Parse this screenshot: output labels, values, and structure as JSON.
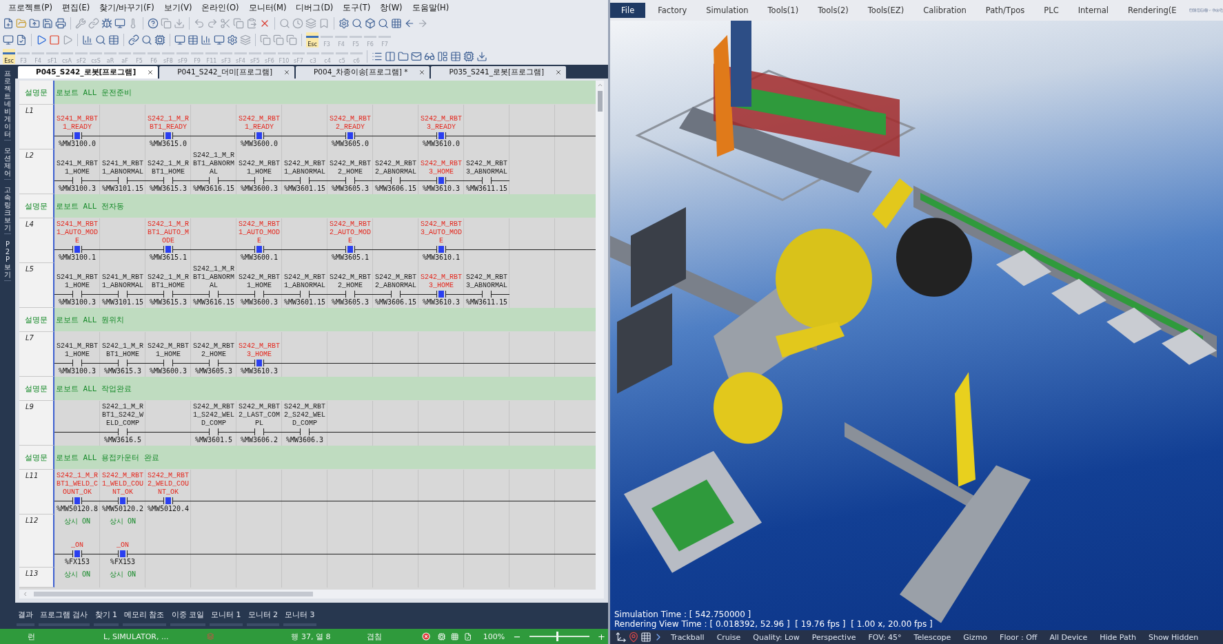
{
  "menu": [
    "프로젝트(P)",
    "편집(E)",
    "찾기/바꾸기(F)",
    "보기(V)",
    "온라인(O)",
    "모니터(M)",
    "디버그(D)",
    "도구(T)",
    "창(W)",
    "도움말(H)"
  ],
  "toolbar_row2_keys": [
    {
      "label": "Esc",
      "disabled": false
    },
    {
      "label": "F3",
      "disabled": true
    },
    {
      "label": "F4",
      "disabled": true
    },
    {
      "label": "F5",
      "disabled": true
    },
    {
      "label": "F6",
      "disabled": true
    },
    {
      "label": "F7",
      "disabled": true
    }
  ],
  "toolbar_row3_keys": [
    {
      "label": "Esc",
      "disabled": false
    },
    {
      "label": "F3",
      "disabled": true
    },
    {
      "label": "F4",
      "disabled": true
    },
    {
      "label": "sF1",
      "disabled": true
    },
    {
      "label": "csA",
      "disabled": true
    },
    {
      "label": "sF2",
      "disabled": true
    },
    {
      "label": "csS",
      "disabled": true
    },
    {
      "label": "aR",
      "disabled": true
    },
    {
      "label": "aF",
      "disabled": true
    },
    {
      "label": "F5",
      "disabled": true
    },
    {
      "label": "F6",
      "disabled": true
    },
    {
      "label": "sF8",
      "disabled": true
    },
    {
      "label": "sF9",
      "disabled": true
    },
    {
      "label": "F9",
      "disabled": true
    },
    {
      "label": "F11",
      "disabled": true
    },
    {
      "label": "sF3",
      "disabled": true
    },
    {
      "label": "sF4",
      "disabled": true
    },
    {
      "label": "sF5",
      "disabled": true
    },
    {
      "label": "sF6",
      "disabled": true
    },
    {
      "label": "F10",
      "disabled": true
    },
    {
      "label": "sF7",
      "disabled": true
    },
    {
      "label": "c3",
      "disabled": true
    },
    {
      "label": "c4",
      "disabled": true
    },
    {
      "label": "c5",
      "disabled": true
    },
    {
      "label": "c6",
      "disabled": true
    }
  ],
  "side_tabs": [
    "프로젝트 네비게이터",
    "모션제어",
    "고속링크 보기",
    "P2P 보기"
  ],
  "tabs": [
    {
      "label": "P045_S242_로봇[프로그램]",
      "selected": true
    },
    {
      "label": "P041_S242_더미[프로그램]",
      "selected": false
    },
    {
      "label": "P004_차종이송[프로그램] *",
      "selected": false
    },
    {
      "label": "P035_S241_로봇[프로그램]",
      "selected": false
    }
  ],
  "ladder": {
    "rungs": [
      {
        "kind": "comment",
        "label": "설명문",
        "text": "로보트 ALL 운전준비"
      },
      {
        "kind": "line",
        "label": "L1",
        "wire_to_end": true,
        "cells": [
          {
            "kind": "contact",
            "name": "S241_M_RBT1_READY",
            "address": "%MW3100.0",
            "on": true
          },
          {
            "kind": "blank"
          },
          {
            "kind": "contact",
            "name": "S242_1_M_RBT1_READY",
            "address": "%MW3615.0",
            "on": true
          },
          {
            "kind": "blank"
          },
          {
            "kind": "contact",
            "name": "S242_M_RBT1_READY",
            "address": "%MW3600.0",
            "on": true
          },
          {
            "kind": "blank"
          },
          {
            "kind": "contact",
            "name": "S242_M_RBT2_READY",
            "address": "%MW3605.0",
            "on": true
          },
          {
            "kind": "blank"
          },
          {
            "kind": "contact",
            "name": "S242_M_RBT3_READY",
            "address": "%MW3610.0",
            "on": true
          }
        ]
      },
      {
        "kind": "line",
        "label": "L2",
        "wire_to_end": false,
        "cells": [
          {
            "kind": "contact",
            "name": "S241_M_RBT1_HOME",
            "address": "%MW3100.3",
            "on": false
          },
          {
            "kind": "contact",
            "name": "S241_M_RBT1_ABNORMAL",
            "address": "%MW3101.15",
            "on": false
          },
          {
            "kind": "contact",
            "name": "S242_1_M_RBT1_HOME",
            "address": "%MW3615.3",
            "on": false
          },
          {
            "kind": "contact",
            "name": "S242_1_M_RBT1_ABNORMAL",
            "address": "%MW3616.15",
            "on": false
          },
          {
            "kind": "contact",
            "name": "S242_M_RBT1_HOME",
            "address": "%MW3600.3",
            "on": false
          },
          {
            "kind": "contact",
            "name": "S242_M_RBT1_ABNORMAL",
            "address": "%MW3601.15",
            "on": false
          },
          {
            "kind": "contact",
            "name": "S242_M_RBT2_HOME",
            "address": "%MW3605.3",
            "on": false
          },
          {
            "kind": "contact",
            "name": "S242_M_RBT2_ABNORMAL",
            "address": "%MW3606.15",
            "on": false
          },
          {
            "kind": "contact",
            "name": "S242_M_RBT3_HOME",
            "address": "%MW3610.3",
            "on": true
          },
          {
            "kind": "contact",
            "name": "S242_M_RBT3_ABNORMAL",
            "address": "%MW3611.15",
            "on": false
          }
        ]
      },
      {
        "kind": "comment",
        "label": "설명문",
        "text": "로보트 ALL 전자동"
      },
      {
        "kind": "line",
        "label": "L4",
        "wire_to_end": true,
        "cells": [
          {
            "kind": "contact",
            "name": "S241_M_RBT1_AUTO_MODE",
            "address": "%MW3100.1",
            "on": true
          },
          {
            "kind": "blank"
          },
          {
            "kind": "contact",
            "name": "S242_1_M_RBT1_AUTO_MODE",
            "address": "%MW3615.1",
            "on": true
          },
          {
            "kind": "blank"
          },
          {
            "kind": "contact",
            "name": "S242_M_RBT1_AUTO_MODE",
            "address": "%MW3600.1",
            "on": true
          },
          {
            "kind": "blank"
          },
          {
            "kind": "contact",
            "name": "S242_M_RBT2_AUTO_MODE",
            "address": "%MW3605.1",
            "on": true
          },
          {
            "kind": "blank"
          },
          {
            "kind": "contact",
            "name": "S242_M_RBT3_AUTO_MODE",
            "address": "%MW3610.1",
            "on": true
          }
        ]
      },
      {
        "kind": "line",
        "label": "L5",
        "wire_to_end": false,
        "cells": [
          {
            "kind": "contact",
            "name": "S241_M_RBT1_HOME",
            "address": "%MW3100.3",
            "on": false
          },
          {
            "kind": "contact",
            "name": "S241_M_RBT1_ABNORMAL",
            "address": "%MW3101.15",
            "on": false
          },
          {
            "kind": "contact",
            "name": "S242_1_M_RBT1_HOME",
            "address": "%MW3615.3",
            "on": false
          },
          {
            "kind": "contact",
            "name": "S242_1_M_RBT1_ABNORMAL",
            "address": "%MW3616.15",
            "on": false
          },
          {
            "kind": "contact",
            "name": "S242_M_RBT1_HOME",
            "address": "%MW3600.3",
            "on": false
          },
          {
            "kind": "contact",
            "name": "S242_M_RBT1_ABNORMAL",
            "address": "%MW3601.15",
            "on": false
          },
          {
            "kind": "contact",
            "name": "S242_M_RBT2_HOME",
            "address": "%MW3605.3",
            "on": false
          },
          {
            "kind": "contact",
            "name": "S242_M_RBT2_ABNORMAL",
            "address": "%MW3606.15",
            "on": false
          },
          {
            "kind": "contact",
            "name": "S242_M_RBT3_HOME",
            "address": "%MW3610.3",
            "on": true
          },
          {
            "kind": "contact",
            "name": "S242_M_RBT3_ABNORMAL",
            "address": "%MW3611.15",
            "on": false
          }
        ]
      },
      {
        "kind": "comment",
        "label": "설명문",
        "text": "로보트 ALL 원위치"
      },
      {
        "kind": "line",
        "label": "L7",
        "wire_to_end": true,
        "cells": [
          {
            "kind": "contact",
            "name": "S241_M_RBT1_HOME",
            "address": "%MW3100.3",
            "on": false
          },
          {
            "kind": "contact",
            "name": "S242_1_M_RBT1_HOME",
            "address": "%MW3615.3",
            "on": false
          },
          {
            "kind": "contact",
            "name": "S242_M_RBT1_HOME",
            "address": "%MW3600.3",
            "on": false
          },
          {
            "kind": "contact",
            "name": "S242_M_RBT2_HOME",
            "address": "%MW3605.3",
            "on": false
          },
          {
            "kind": "contact",
            "name": "S242_M_RBT3_HOME",
            "address": "%MW3610.3",
            "on": true
          }
        ]
      },
      {
        "kind": "comment",
        "label": "설명문",
        "text": "로보트 ALL 작업완료"
      },
      {
        "kind": "line",
        "label": "L9",
        "wire_to_end": true,
        "cells": [
          {
            "kind": "blank"
          },
          {
            "kind": "contact",
            "name": "S242_1_M_RBT1_S242_WELD_COMP",
            "address": "%MW3616.5",
            "on": false
          },
          {
            "kind": "blank"
          },
          {
            "kind": "contact",
            "name": "S242_M_RBT1_S242_WELD_COMP",
            "address": "%MW3601.5",
            "on": false
          },
          {
            "kind": "contact",
            "name": "S242_M_RBT2_LAST_COMPL",
            "address": "%MW3606.2",
            "on": false
          },
          {
            "kind": "contact",
            "name": "S242_M_RBT2_S242_WELD_COMP",
            "address": "%MW3606.3",
            "on": false
          }
        ]
      },
      {
        "kind": "comment",
        "label": "설명문",
        "text": "로보트 ALL 용접카운터 완료"
      },
      {
        "kind": "line",
        "label": "L11",
        "wire_to_end": true,
        "cells": [
          {
            "kind": "contact",
            "name": "S242_1_M_RBT1_WELD_COUNT_OK",
            "address": "%MW50120.8",
            "on": true
          },
          {
            "kind": "contact",
            "name": "S242_M_RBT1_WELD_COUNT_OK",
            "address": "%MW50120.2",
            "on": true
          },
          {
            "kind": "contact",
            "name": "S242_M_RBT2_WELD_COUNT_OK",
            "address": "%MW50120.4",
            "on": true
          }
        ]
      },
      {
        "kind": "line",
        "label": "L12",
        "wire_to_end": true,
        "cells": [
          {
            "kind": "contact",
            "note": "상시 ON",
            "name": "_ON",
            "address": "%FX153",
            "on": true
          },
          {
            "kind": "contact",
            "note": "상시 ON",
            "name": "_ON",
            "address": "%FX153",
            "on": true
          }
        ]
      },
      {
        "kind": "line",
        "label": "L13",
        "wire_to_end": false,
        "cells": [
          {
            "kind": "note",
            "note": "상시 ON"
          },
          {
            "kind": "note",
            "note": "상시 ON"
          }
        ]
      }
    ]
  },
  "bottom_tabs": [
    "결과",
    "프로그램 검사",
    "찾기 1",
    "메모리 참조",
    "이중 코일",
    "모니터 1",
    "모니터 2",
    "모니터 3"
  ],
  "status_bar": {
    "mode": "런",
    "connection": "L, SIMULATOR, ...",
    "position": "행 37, 열 8",
    "insert_mode": "겹침",
    "zoom": "100%",
    "zoom_out": "−",
    "zoom_in": "+",
    "zoom_slider": {
      "level": 0.45
    }
  },
  "viewer": {
    "menu": [
      {
        "label": "File",
        "selected": true
      },
      {
        "label": "Factory",
        "selected": false
      },
      {
        "label": "Simulation",
        "selected": false
      },
      {
        "label": "Tools(1)",
        "selected": false
      },
      {
        "label": "Tools(2)",
        "selected": false
      },
      {
        "label": "Tools(EZ)",
        "selected": false
      },
      {
        "label": "Calibration",
        "selected": false
      },
      {
        "label": "Path/Tpos",
        "selected": false
      },
      {
        "label": "PLC",
        "selected": false
      },
      {
        "label": "Internal",
        "selected": false
      },
      {
        "label": "Rendering(E",
        "selected": false
      }
    ],
    "overlay": [
      "Simulation Time : [ 542.750000 ]",
      "Rendering View Time : [ 0.018392, 52.96 ]  [ 19.76 fps ]  [ 1.00 x, 20.00 fps ]"
    ],
    "toolbar": [
      "Trackball",
      "Cruise",
      "Quality: Low",
      "Perspective",
      "FOV: 45°",
      "Telescope",
      "Gizmo",
      "Floor : Off",
      "All Device",
      "Hide Path",
      "Show Hidden"
    ]
  }
}
